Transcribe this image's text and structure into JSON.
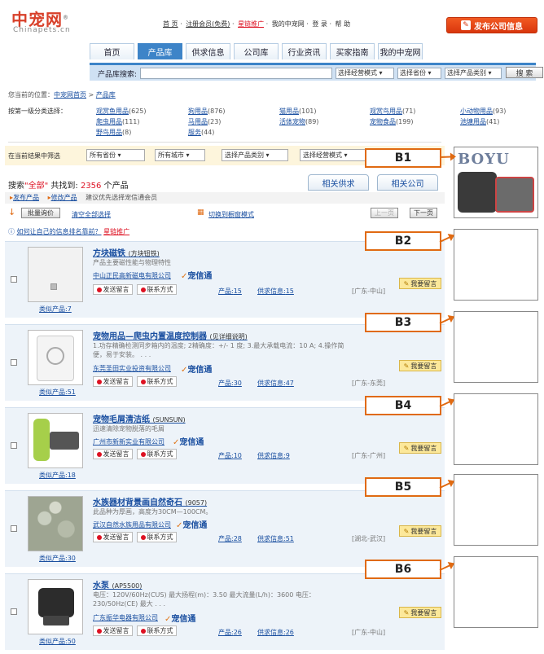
{
  "header": {
    "logo_cn": "中宠网",
    "logo_reg": "®",
    "logo_en": "Chinapets.cn",
    "links": [
      "首 页",
      "注册会员(免费)",
      "星链推广",
      "我的中宠网",
      "登 录",
      "帮 助"
    ],
    "link_sep": "·",
    "publish_button": "发布公司信息"
  },
  "tabs": [
    "首页",
    "产品库",
    "供求信息",
    "公司库",
    "行业资讯",
    "买家指南",
    "我的中宠网"
  ],
  "active_tab": 1,
  "search": {
    "label": "产品库搜索:",
    "value": "",
    "mode": "选择经营模式",
    "province": "选择省份",
    "category": "选择产品类别",
    "button": "搜 索"
  },
  "breadcrumb": {
    "prefix": "您当前的位置：",
    "home": "中宠网首页",
    "sep": " > ",
    "current": "产品库"
  },
  "category_label": "按第一级分类选择：",
  "categories": [
    {
      "name": "观赏鱼用品",
      "count": "(625)"
    },
    {
      "name": "狗用品",
      "count": "(876)"
    },
    {
      "name": "猫用品",
      "count": "(101)"
    },
    {
      "name": "观赏鸟用品",
      "count": "(71)"
    },
    {
      "name": "小动物用品",
      "count": "(93)"
    },
    {
      "name": "爬虫用品",
      "count": "(111)"
    },
    {
      "name": "马用品",
      "count": "(23)"
    },
    {
      "name": "活体宠物",
      "count": "(89)"
    },
    {
      "name": "宠物食品",
      "count": "(199)"
    },
    {
      "name": "池塘用品",
      "count": "(41)"
    },
    {
      "name": "野鸟用品",
      "count": "(8)"
    },
    {
      "name": "服务",
      "count": "(44)"
    }
  ],
  "filter": {
    "label": "在当前结果中筛选",
    "province": "所有省份",
    "city": "所有城市",
    "category": "选择产品类别",
    "mode": "选择经营模式"
  },
  "results": {
    "prefix": "搜索",
    "query": "\"全部\"",
    "found_label": "共找到:",
    "count": "2356",
    "suffix": "个产品"
  },
  "related_tabs": [
    "相关供求",
    "相关公司"
  ],
  "actions": {
    "publish": "发布产品",
    "edit": "修改产品",
    "tip": "建议优先选择宠信通会员"
  },
  "toolbar": {
    "batch": "批量询价",
    "clear": "清空全部选择",
    "switch": "切换到橱窗模式",
    "prev": "上一页",
    "next": "下一页"
  },
  "promo": {
    "question": "如何让自己的信息排名靠前？",
    "link": "星链推广"
  },
  "item_common": {
    "leave_msg": "发送留言",
    "contact": "联系方式",
    "trust": "宠信通",
    "message_btn": "我要留言",
    "products_label": "产品:",
    "supply_label": "供求信息:"
  },
  "items": [
    {
      "title": "方块磁铁",
      "sub": "(方块钮铁)",
      "desc": "产品主要磁性能与物理特性",
      "company": "中山正民高新磁电有限公司",
      "products": "15",
      "supply": "15",
      "loc": "[广东-中山]",
      "similar": "类似产品:7"
    },
    {
      "title": "宠物用品—爬虫内置温度控制器",
      "sub": "(见详细说明)",
      "desc": "1.功存精确检测同步箱内的温度; 2精确度：+/- 1 度; 3.最大承载电流：10 A; 4.操作简便，易于安装。 . . .",
      "company": "东莞圣田实业投资有限公司",
      "products": "30",
      "supply": "47",
      "loc": "[广东-东莞]",
      "similar": "类似产品:51"
    },
    {
      "title": "宠物毛屑清洁纸",
      "sub": "(SUNSUN)",
      "desc": "迅速清除宠物脱落的毛屑",
      "company": "广州市新新实业有限公司",
      "products": "10",
      "supply": "9",
      "loc": "[广东-广州]",
      "similar": "类似产品:18"
    },
    {
      "title": "水族器材背景画自然奇石",
      "sub": "(9057)",
      "desc": "此品种为厚画，高度为30CM—100CM。",
      "company": "武汉自然水族用品有限公司",
      "products": "28",
      "supply": "51",
      "loc": "[湖北-武汉]",
      "similar": "类似产品:30"
    },
    {
      "title": "水泵",
      "sub": "(AP5500)",
      "desc": "电压：120V/60Hz(CUS) 最大扬程(m)：3.50 最大流量(L/h)：3600 电压：230/50Hz(CE) 最大 . . .",
      "company": "广东振华电器有限公司",
      "products": "26",
      "supply": "26",
      "loc": "[广东-中山]",
      "similar": "类似产品:50"
    }
  ],
  "callouts": [
    "B1",
    "B2",
    "B3",
    "B4",
    "B5",
    "B6"
  ],
  "ad_brand": "BOYU",
  "colors": {
    "accent": "#3d84c8",
    "red": "#d12",
    "callout": "#e06a12"
  }
}
